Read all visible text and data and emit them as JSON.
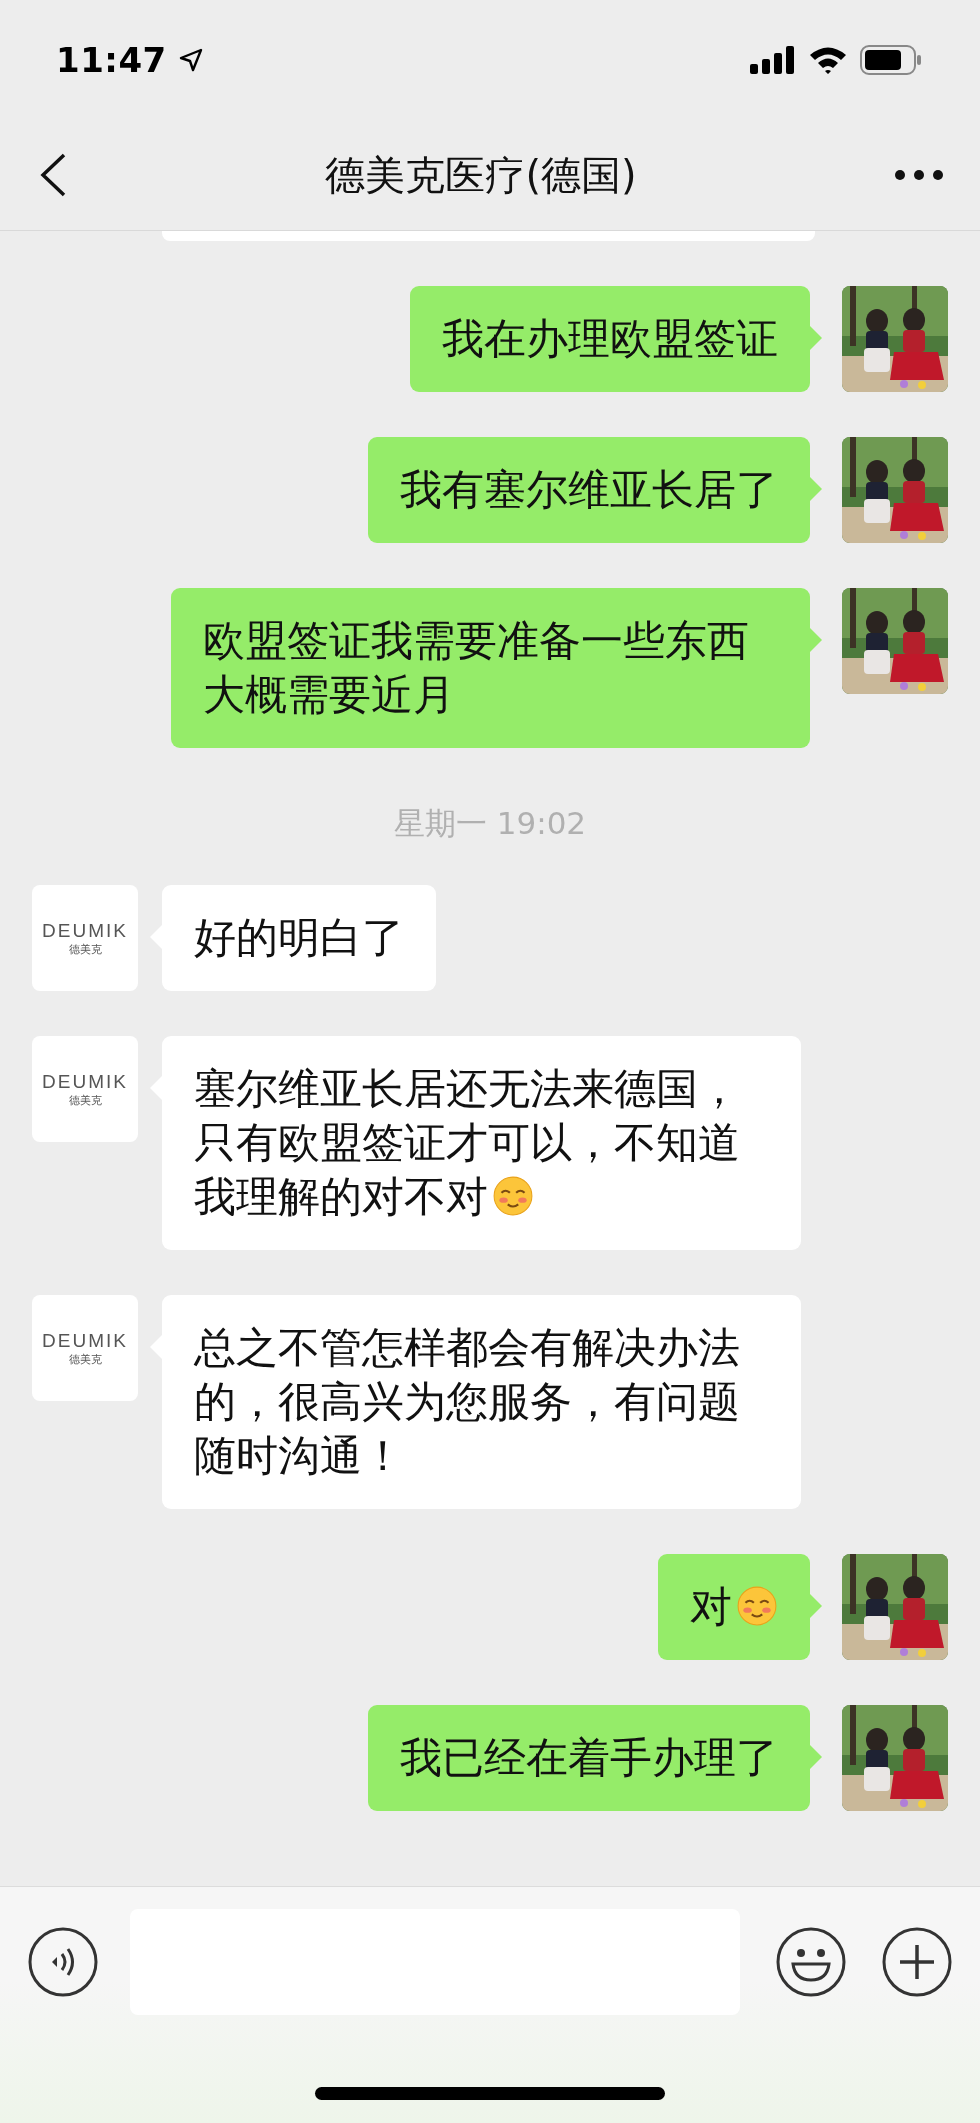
{
  "status_bar": {
    "time": "11:47"
  },
  "header": {
    "title": "德美克医疗(德国)"
  },
  "messages": [
    {
      "kind": "sent",
      "text": "我在办理欧盟签证",
      "emoji": false
    },
    {
      "kind": "sent",
      "text": "我有塞尔维亚长居了",
      "emoji": false
    },
    {
      "kind": "sent",
      "text": "欧盟签证我需要准备一些东西大概需要近月",
      "emoji": false
    },
    {
      "kind": "timestamp",
      "text": "星期一 19:02"
    },
    {
      "kind": "received",
      "text": "好的明白了",
      "emoji": false,
      "avatar": {
        "kind": "logo",
        "wordmark": "DEUMIK",
        "caption": "德美克"
      }
    },
    {
      "kind": "received",
      "text": "塞尔维亚长居还无法来德国，只有欧盟签证才可以，不知道我理解的对不对",
      "emoji": true,
      "avatar": {
        "kind": "logo",
        "wordmark": "DEUMIK",
        "caption": "德美克"
      }
    },
    {
      "kind": "received",
      "text": "总之不管怎样都会有解决办法的，很高兴为您服务，有问题随时沟通！",
      "emoji": false,
      "avatar": {
        "kind": "logo",
        "wordmark": "DEUMIK",
        "caption": "德美克"
      }
    },
    {
      "kind": "sent",
      "text": "对",
      "emoji": true
    },
    {
      "kind": "sent",
      "text": "我已经在着手办理了",
      "emoji": false
    }
  ]
}
